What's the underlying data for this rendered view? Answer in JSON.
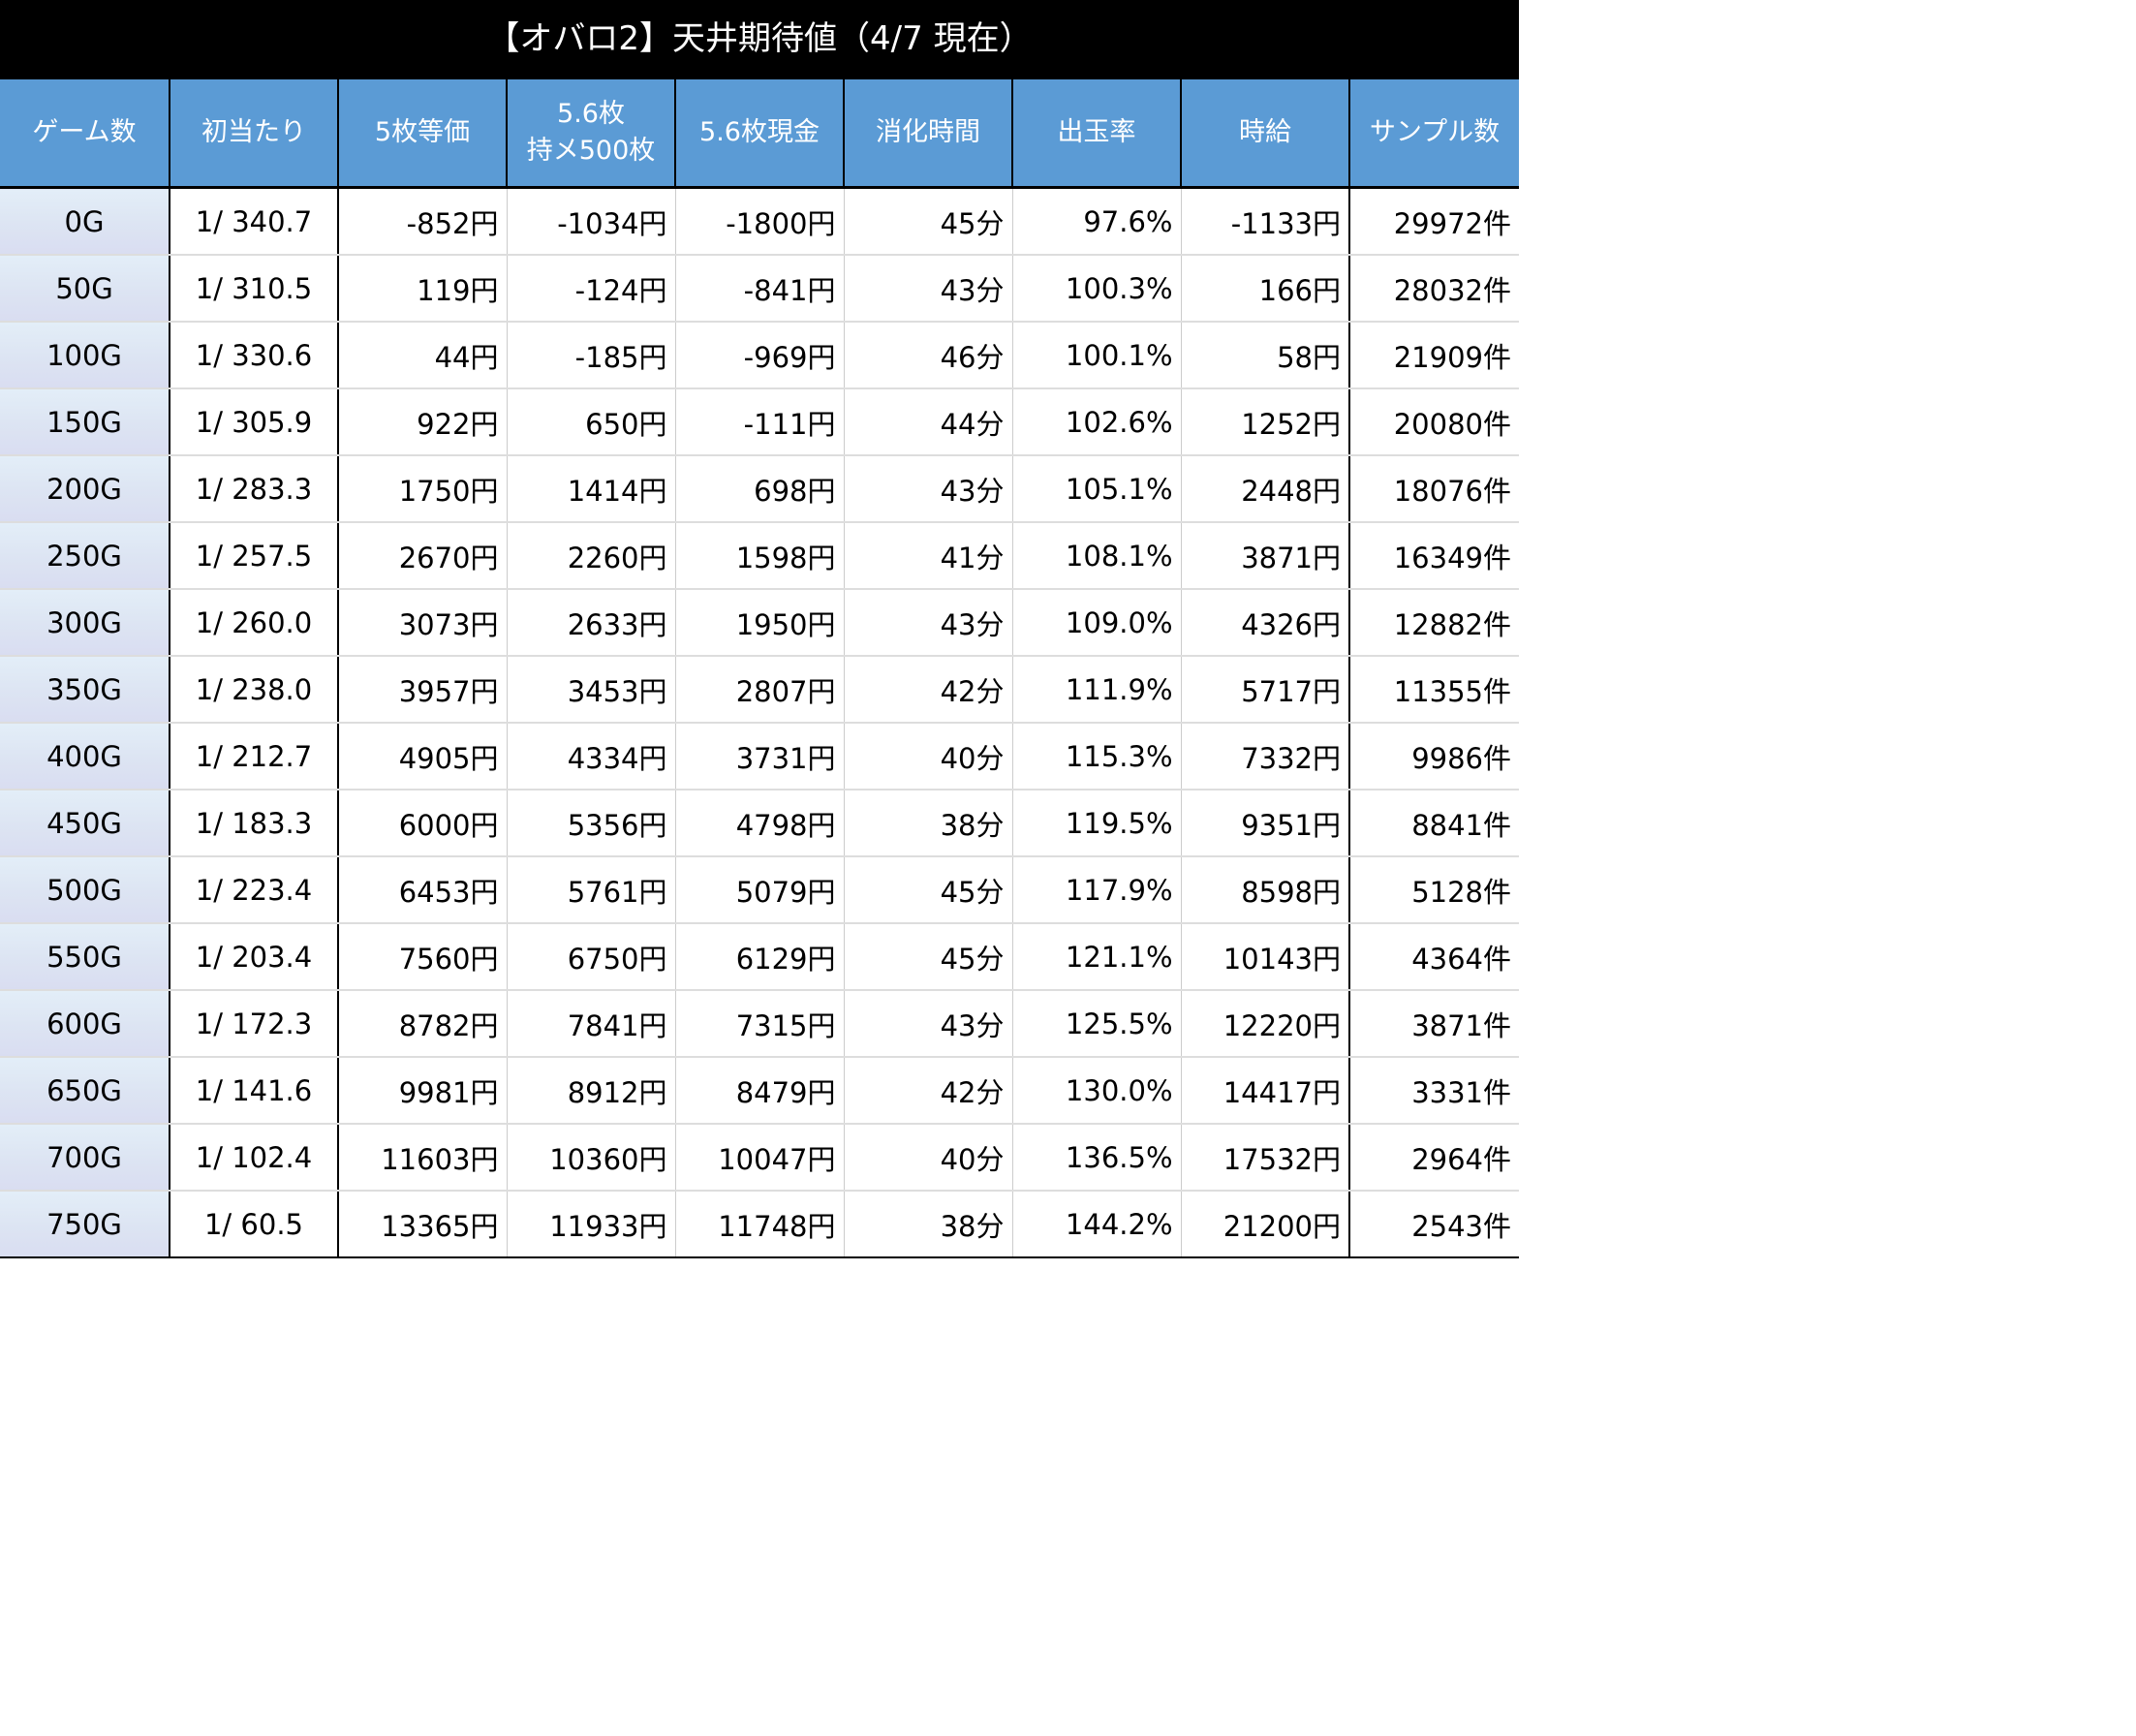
{
  "title": "【オバロ2】天井期待値（4/7 現在）",
  "colors": {
    "positive": "#1a12e6",
    "negative": "#ee1a1a",
    "header_bg": "#5b9bd5"
  },
  "headers": [
    {
      "line1": "ゲーム数",
      "line2": ""
    },
    {
      "line1": "初当たり",
      "line2": ""
    },
    {
      "line1": "5枚等価",
      "line2": ""
    },
    {
      "line1": "5.6枚",
      "line2": "持メ500枚"
    },
    {
      "line1": "5.6枚現金",
      "line2": ""
    },
    {
      "line1": "消化時間",
      "line2": ""
    },
    {
      "line1": "出玉率",
      "line2": ""
    },
    {
      "line1": "時給",
      "line2": ""
    },
    {
      "line1": "サンプル数",
      "line2": ""
    }
  ],
  "rows": [
    {
      "game": "0G",
      "hit": "1/ 340.7",
      "v5": "-852円",
      "v56m": "-1034円",
      "v56c": "-1800円",
      "time": "45分",
      "rate": "97.6%",
      "hourly": "-1133円",
      "samples": "29972件"
    },
    {
      "game": "50G",
      "hit": "1/ 310.5",
      "v5": "119円",
      "v56m": "-124円",
      "v56c": "-841円",
      "time": "43分",
      "rate": "100.3%",
      "hourly": "166円",
      "samples": "28032件"
    },
    {
      "game": "100G",
      "hit": "1/ 330.6",
      "v5": "44円",
      "v56m": "-185円",
      "v56c": "-969円",
      "time": "46分",
      "rate": "100.1%",
      "hourly": "58円",
      "samples": "21909件"
    },
    {
      "game": "150G",
      "hit": "1/ 305.9",
      "v5": "922円",
      "v56m": "650円",
      "v56c": "-111円",
      "time": "44分",
      "rate": "102.6%",
      "hourly": "1252円",
      "samples": "20080件"
    },
    {
      "game": "200G",
      "hit": "1/ 283.3",
      "v5": "1750円",
      "v56m": "1414円",
      "v56c": "698円",
      "time": "43分",
      "rate": "105.1%",
      "hourly": "2448円",
      "samples": "18076件"
    },
    {
      "game": "250G",
      "hit": "1/ 257.5",
      "v5": "2670円",
      "v56m": "2260円",
      "v56c": "1598円",
      "time": "41分",
      "rate": "108.1%",
      "hourly": "3871円",
      "samples": "16349件"
    },
    {
      "game": "300G",
      "hit": "1/ 260.0",
      "v5": "3073円",
      "v56m": "2633円",
      "v56c": "1950円",
      "time": "43分",
      "rate": "109.0%",
      "hourly": "4326円",
      "samples": "12882件"
    },
    {
      "game": "350G",
      "hit": "1/ 238.0",
      "v5": "3957円",
      "v56m": "3453円",
      "v56c": "2807円",
      "time": "42分",
      "rate": "111.9%",
      "hourly": "5717円",
      "samples": "11355件"
    },
    {
      "game": "400G",
      "hit": "1/ 212.7",
      "v5": "4905円",
      "v56m": "4334円",
      "v56c": "3731円",
      "time": "40分",
      "rate": "115.3%",
      "hourly": "7332円",
      "samples": "9986件"
    },
    {
      "game": "450G",
      "hit": "1/ 183.3",
      "v5": "6000円",
      "v56m": "5356円",
      "v56c": "4798円",
      "time": "38分",
      "rate": "119.5%",
      "hourly": "9351円",
      "samples": "8841件"
    },
    {
      "game": "500G",
      "hit": "1/ 223.4",
      "v5": "6453円",
      "v56m": "5761円",
      "v56c": "5079円",
      "time": "45分",
      "rate": "117.9%",
      "hourly": "8598円",
      "samples": "5128件"
    },
    {
      "game": "550G",
      "hit": "1/ 203.4",
      "v5": "7560円",
      "v56m": "6750円",
      "v56c": "6129円",
      "time": "45分",
      "rate": "121.1%",
      "hourly": "10143円",
      "samples": "4364件"
    },
    {
      "game": "600G",
      "hit": "1/ 172.3",
      "v5": "8782円",
      "v56m": "7841円",
      "v56c": "7315円",
      "time": "43分",
      "rate": "125.5%",
      "hourly": "12220円",
      "samples": "3871件"
    },
    {
      "game": "650G",
      "hit": "1/ 141.6",
      "v5": "9981円",
      "v56m": "8912円",
      "v56c": "8479円",
      "time": "42分",
      "rate": "130.0%",
      "hourly": "14417円",
      "samples": "3331件"
    },
    {
      "game": "700G",
      "hit": "1/ 102.4",
      "v5": "11603円",
      "v56m": "10360円",
      "v56c": "10047円",
      "time": "40分",
      "rate": "136.5%",
      "hourly": "17532円",
      "samples": "2964件"
    },
    {
      "game": "750G",
      "hit": "1/ 60.5",
      "v5": "13365円",
      "v56m": "11933円",
      "v56c": "11748円",
      "time": "38分",
      "rate": "144.2%",
      "hourly": "21200円",
      "samples": "2543件"
    }
  ]
}
